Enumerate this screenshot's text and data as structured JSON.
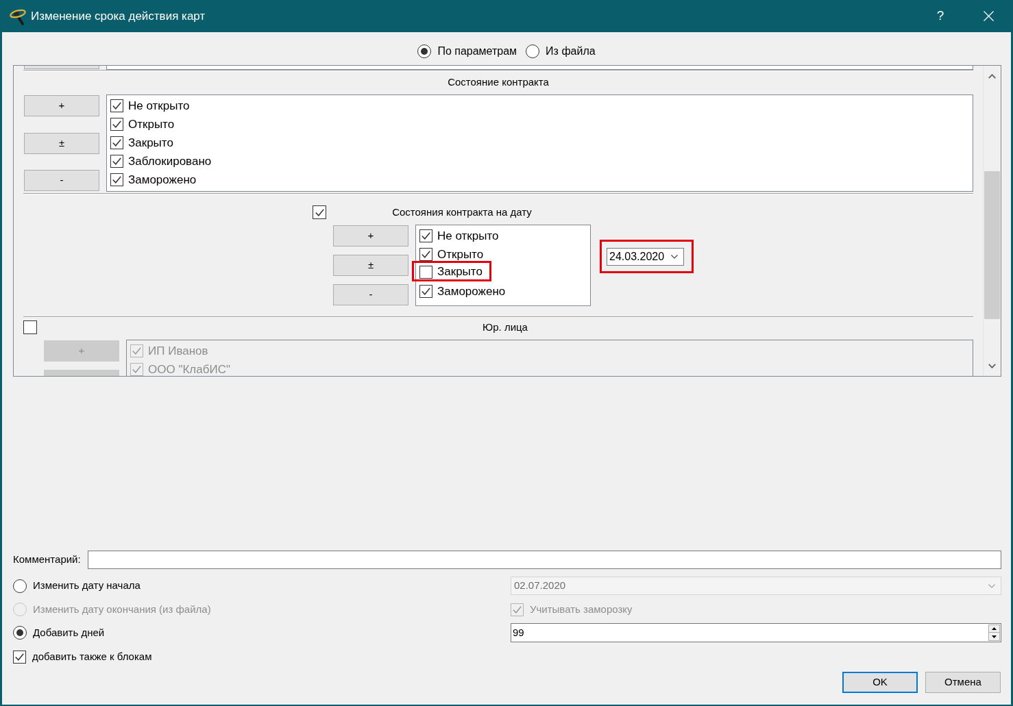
{
  "window": {
    "title": "Изменение срока действия карт",
    "help": "?"
  },
  "source_options": [
    {
      "label": "По параметрам",
      "selected": true
    },
    {
      "label": "Из файла",
      "selected": false
    }
  ],
  "filter_sections": [
    {
      "kind": "clipped"
    },
    {
      "kind": "plain",
      "title": "Состояние контракта",
      "buttons": [
        "+",
        "±",
        "-"
      ],
      "items": [
        {
          "label": "Не открыто",
          "checked": true
        },
        {
          "label": "Открыто",
          "checked": true
        },
        {
          "label": "Закрыто",
          "checked": true
        },
        {
          "label": "Заблокировано",
          "checked": true
        },
        {
          "label": "Заморожено",
          "checked": true
        }
      ]
    },
    {
      "kind": "dated",
      "title": "Состояния контракта на дату",
      "enabled": true,
      "buttons": [
        "+",
        "±",
        "-"
      ],
      "items": [
        {
          "label": "Не открыто",
          "checked": true,
          "highlighted": false
        },
        {
          "label": "Открыто",
          "checked": true,
          "highlighted": false
        },
        {
          "label": "Закрыто",
          "checked": false,
          "highlighted": true
        },
        {
          "label": "Заморожено",
          "checked": true,
          "highlighted": false
        }
      ],
      "date": {
        "value": "24.03.2020",
        "highlighted": true
      }
    },
    {
      "kind": "toggle",
      "title": "Юр. лица",
      "enabled": false,
      "buttons": [
        "+"
      ],
      "items": [
        {
          "label": "ИП Иванов",
          "checked": true
        },
        {
          "label": "ООО \"КлабИС\"",
          "checked": true
        }
      ]
    }
  ],
  "comment": {
    "label": "Комментарий:"
  },
  "date_modes": [
    {
      "label": "Изменить дату начала",
      "selected": false,
      "disabled": false
    },
    {
      "label": "Изменить дату окончания (из файла)",
      "selected": false,
      "disabled": true
    },
    {
      "label": "Добавить дней",
      "selected": true,
      "disabled": false
    }
  ],
  "start_date": {
    "value": "02.07.2020",
    "disabled": true
  },
  "consider_freeze": {
    "label": "Учитывать заморозку",
    "checked": true,
    "disabled": true
  },
  "days": {
    "value": "99"
  },
  "add_to_blocks": {
    "label": "добавить также к блокам",
    "checked": true
  },
  "buttons": [
    {
      "label": "OK",
      "focused": true
    },
    {
      "label": "Отмена",
      "focused": false
    }
  ]
}
